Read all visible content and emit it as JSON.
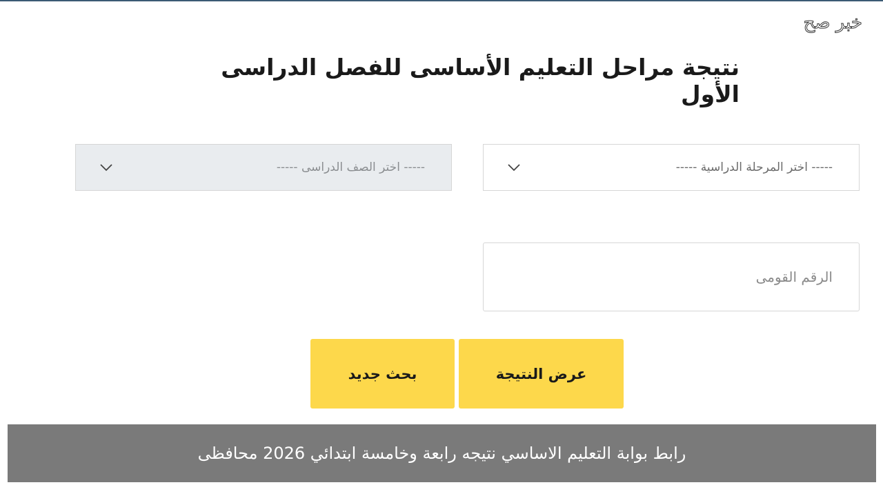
{
  "watermark": "خبر صح",
  "page_title": "نتيجة مراحل التعليم الأساسى للفصل الدراسى الأول",
  "form": {
    "stage_select": {
      "selected_text": "----- اختر المرحلة الدراسية -----",
      "icon": "chevron-down-icon"
    },
    "grade_select": {
      "selected_text": "----- اختر الصف الدراسى -----",
      "icon": "chevron-down-icon",
      "disabled": true
    },
    "national_id": {
      "value": "",
      "placeholder": "الرقم القومى"
    }
  },
  "buttons": {
    "show_result": "عرض النتيجة",
    "new_search": "بحث جديد"
  },
  "caption": "رابط بوابة التعليم الاساسي نتيجه رابعة وخامسة ابتدائي 2026 محافظى",
  "colors": {
    "button_bg": "#fdd84b",
    "caption_bg": "#7a7a7a",
    "disabled_select_bg": "#e9ecef"
  }
}
